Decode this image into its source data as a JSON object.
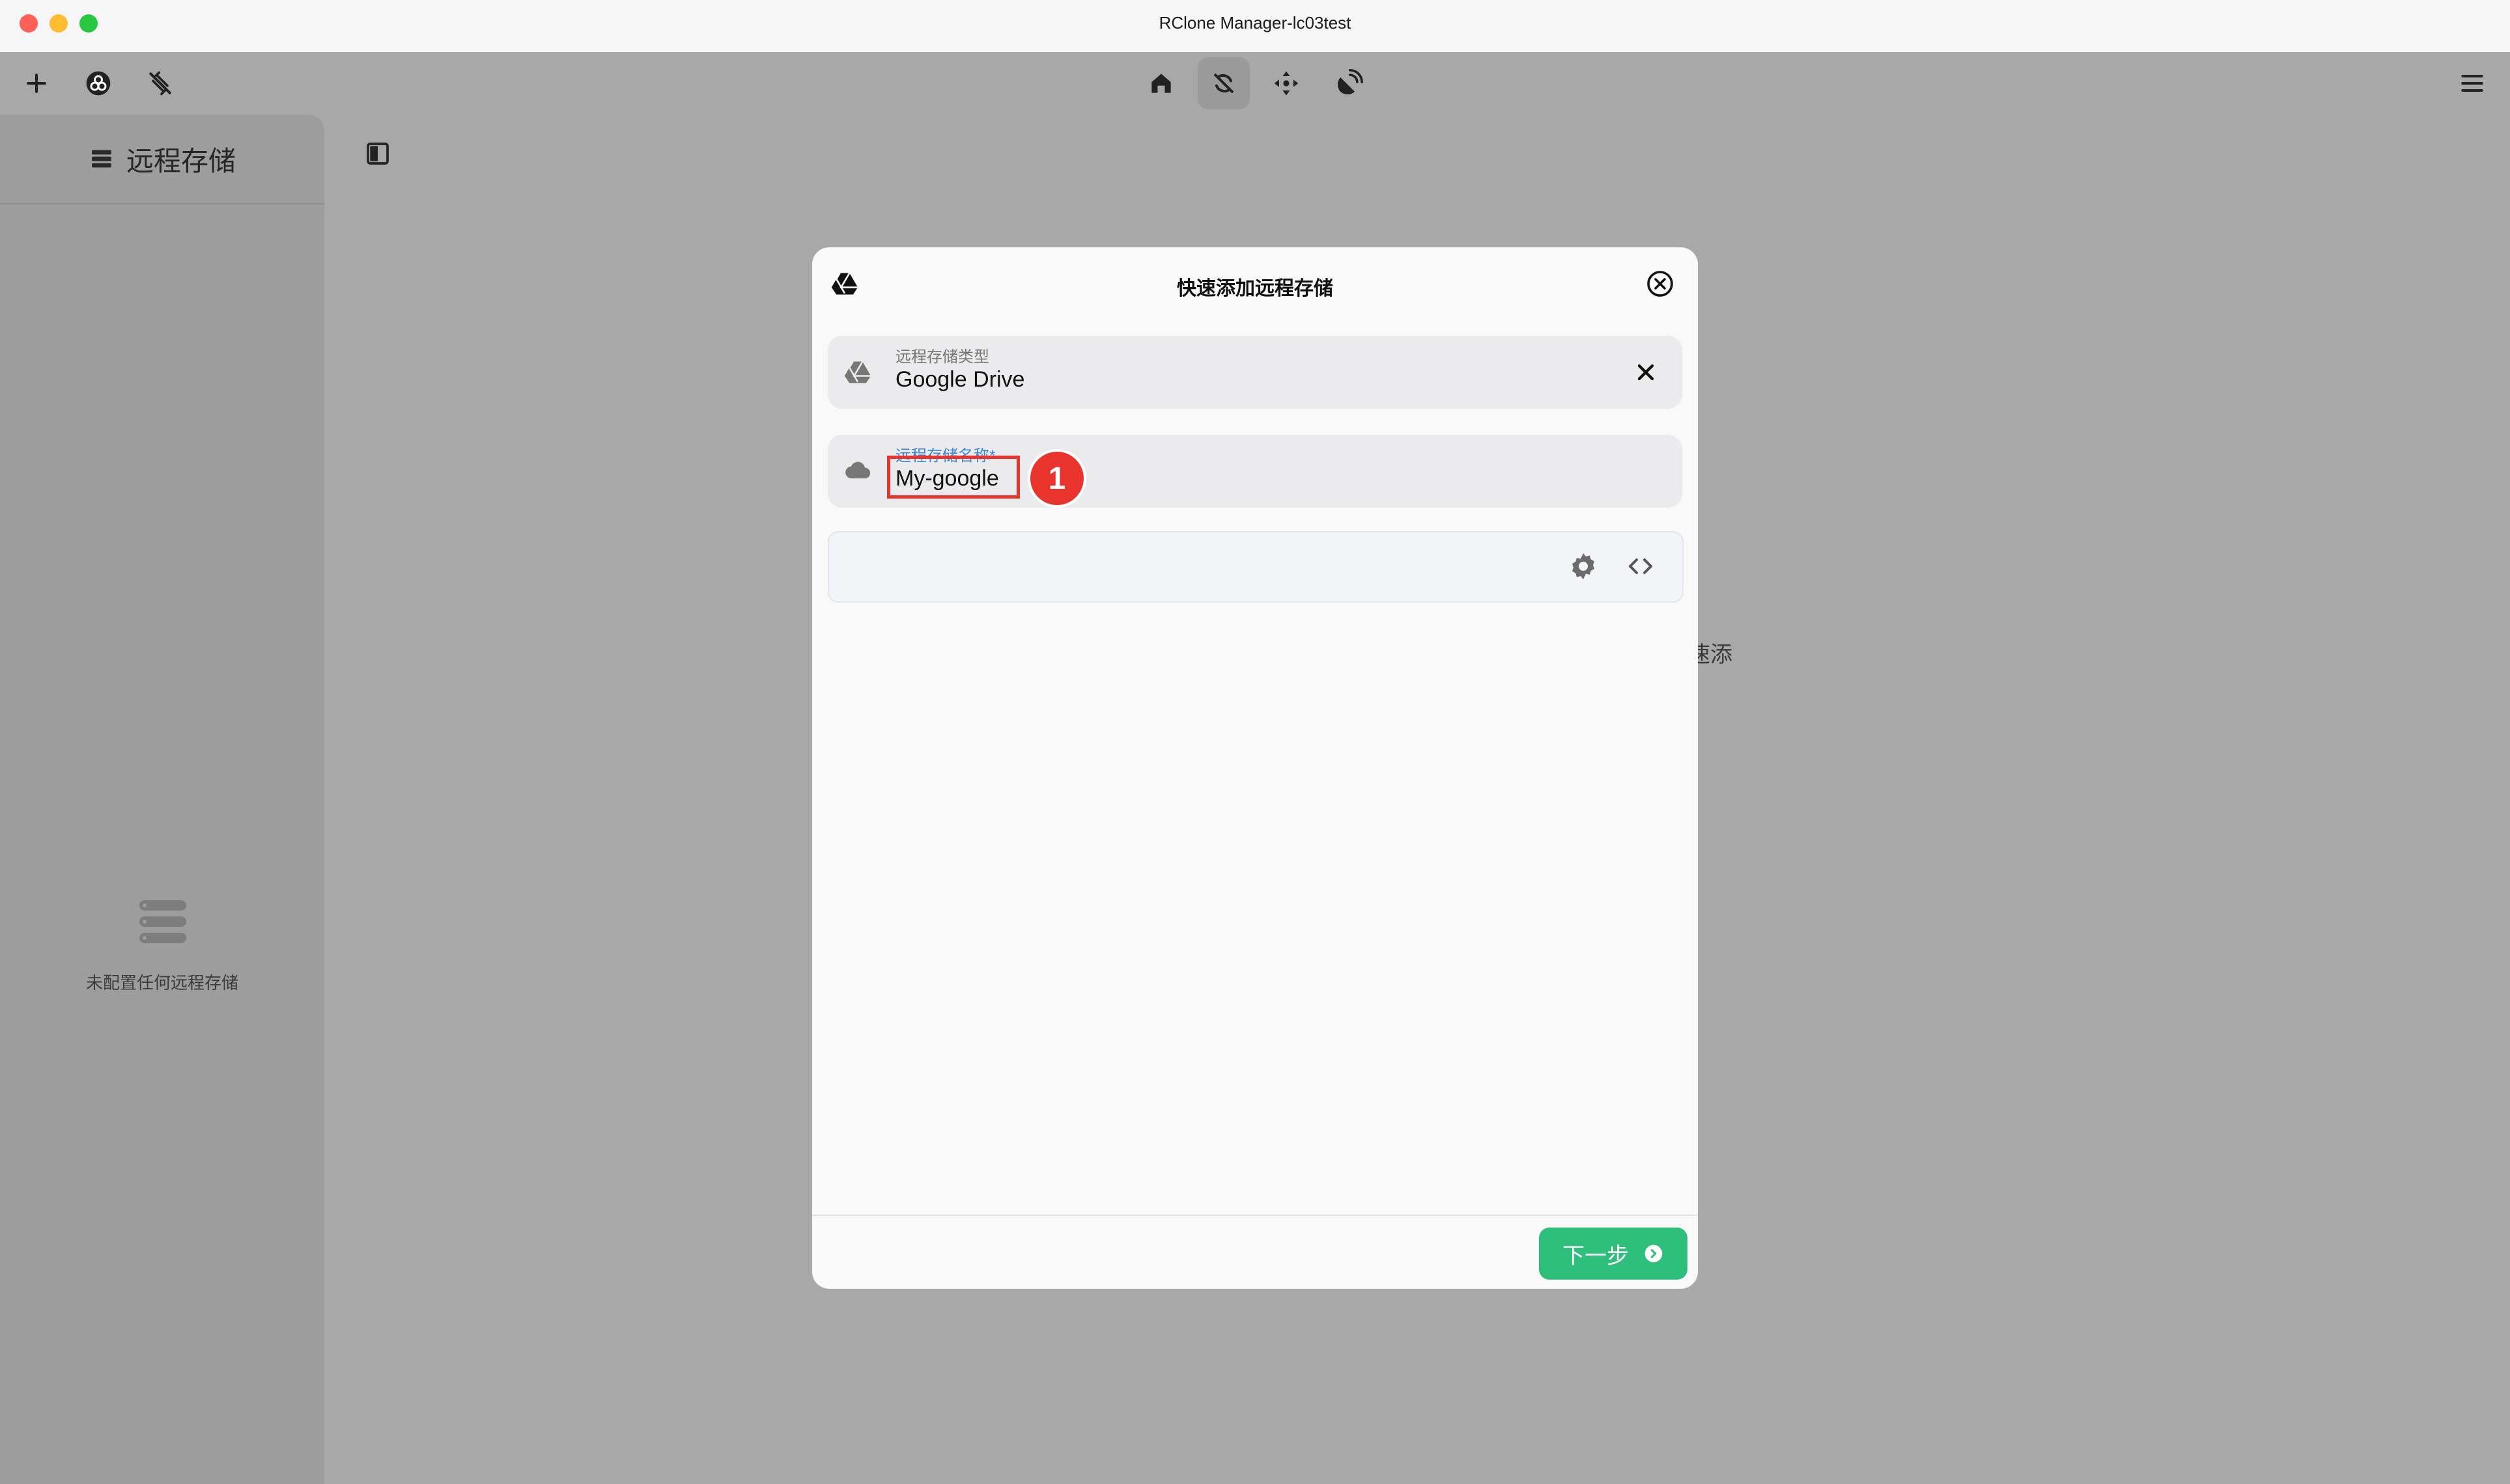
{
  "window": {
    "title": "RClone Manager-lc03test"
  },
  "sidebar": {
    "title": "远程存储",
    "empty_text": "未配置任何远程存储"
  },
  "background": {
    "fragment_text": "速添"
  },
  "dialog": {
    "title": "快速添加远程存储",
    "type_field": {
      "label": "远程存储类型",
      "value": "Google Drive"
    },
    "name_field": {
      "label": "远程存储名称*",
      "value": "My-google"
    },
    "next_label": "下一步"
  },
  "annotation": {
    "marker": "1"
  },
  "icons": {
    "toolbar_left": [
      "add-icon",
      "cloud-logo-icon",
      "disconnected-icon"
    ],
    "nav": [
      "home-icon",
      "sync-icon",
      "move-icon",
      "satellite-icon"
    ],
    "menu": "hamburger-menu-icon"
  },
  "colors": {
    "accent": "#2ebf7c",
    "label_active": "#3a86d6",
    "annotation": "#e8342c"
  }
}
